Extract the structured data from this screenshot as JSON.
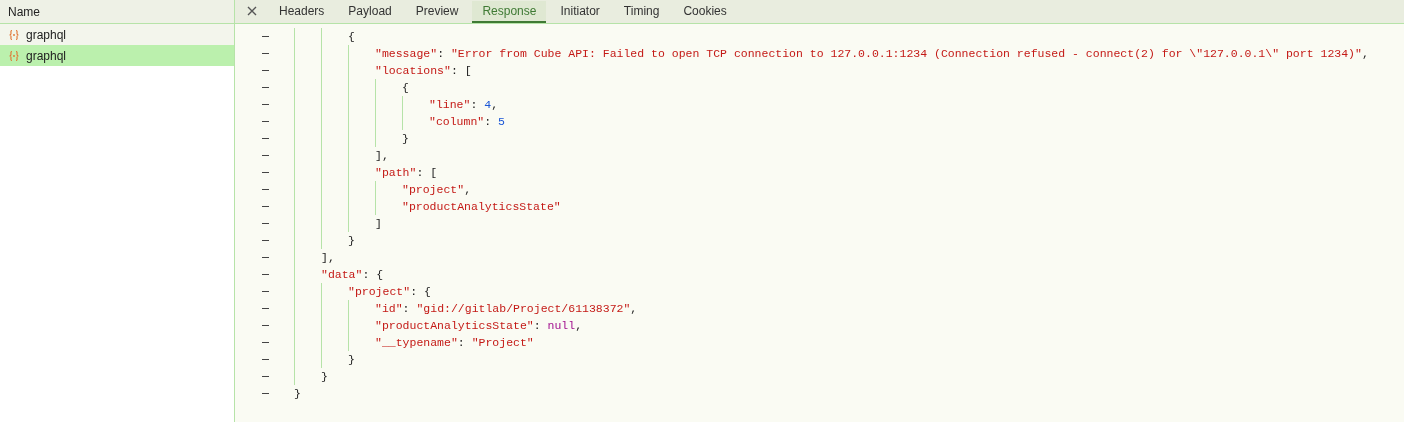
{
  "sidebar": {
    "header": "Name",
    "items": [
      {
        "label": "graphql",
        "selected": false
      },
      {
        "label": "graphql",
        "selected": true
      }
    ]
  },
  "tabs": [
    {
      "label": "Headers",
      "selected": false
    },
    {
      "label": "Payload",
      "selected": false
    },
    {
      "label": "Preview",
      "selected": false
    },
    {
      "label": "Response",
      "selected": true
    },
    {
      "label": "Initiator",
      "selected": false
    },
    {
      "label": "Timing",
      "selected": false
    },
    {
      "label": "Cookies",
      "selected": false
    }
  ],
  "response": [
    {
      "children": [
        {
          "children": [
            {
              "tokens": [
                {
                  "kind": "punct",
                  "text": "{"
                }
              ],
              "children": [
                {
                  "tokens": [
                    {
                      "kind": "key",
                      "text": "\"message\""
                    },
                    {
                      "kind": "punct",
                      "text": ": "
                    },
                    {
                      "kind": "string",
                      "text": "\"Error from Cube API: Failed to open TCP connection to 127.0.0.1:1234 (Connection refused - connect(2) for \\\"127.0.0.1\\\" port 1234)\""
                    },
                    {
                      "kind": "punct",
                      "text": ","
                    }
                  ]
                },
                {
                  "tokens": [
                    {
                      "kind": "key",
                      "text": "\"locations\""
                    },
                    {
                      "kind": "punct",
                      "text": ": ["
                    }
                  ],
                  "children": [
                    {
                      "tokens": [
                        {
                          "kind": "punct",
                          "text": "{"
                        }
                      ],
                      "children": [
                        {
                          "tokens": [
                            {
                              "kind": "key",
                              "text": "\"line\""
                            },
                            {
                              "kind": "punct",
                              "text": ": "
                            },
                            {
                              "kind": "number",
                              "text": "4"
                            },
                            {
                              "kind": "punct",
                              "text": ","
                            }
                          ]
                        },
                        {
                          "tokens": [
                            {
                              "kind": "key",
                              "text": "\"column\""
                            },
                            {
                              "kind": "punct",
                              "text": ": "
                            },
                            {
                              "kind": "number",
                              "text": "5"
                            }
                          ]
                        }
                      ]
                    },
                    {
                      "tokens": [
                        {
                          "kind": "punct",
                          "text": "}"
                        }
                      ]
                    }
                  ]
                },
                {
                  "tokens": [
                    {
                      "kind": "punct",
                      "text": "],"
                    }
                  ]
                },
                {
                  "tokens": [
                    {
                      "kind": "key",
                      "text": "\"path\""
                    },
                    {
                      "kind": "punct",
                      "text": ": ["
                    }
                  ],
                  "children": [
                    {
                      "tokens": [
                        {
                          "kind": "string",
                          "text": "\"project\""
                        },
                        {
                          "kind": "punct",
                          "text": ","
                        }
                      ]
                    },
                    {
                      "tokens": [
                        {
                          "kind": "string",
                          "text": "\"productAnalyticsState\""
                        }
                      ]
                    }
                  ]
                },
                {
                  "tokens": [
                    {
                      "kind": "punct",
                      "text": "]"
                    }
                  ]
                }
              ]
            },
            {
              "tokens": [
                {
                  "kind": "punct",
                  "text": "}"
                }
              ]
            }
          ]
        },
        {
          "tokens": [
            {
              "kind": "punct",
              "text": "],"
            }
          ]
        },
        {
          "tokens": [
            {
              "kind": "key",
              "text": "\"data\""
            },
            {
              "kind": "punct",
              "text": ": {"
            }
          ],
          "children": [
            {
              "tokens": [
                {
                  "kind": "key",
                  "text": "\"project\""
                },
                {
                  "kind": "punct",
                  "text": ": {"
                }
              ],
              "children": [
                {
                  "tokens": [
                    {
                      "kind": "key",
                      "text": "\"id\""
                    },
                    {
                      "kind": "punct",
                      "text": ": "
                    },
                    {
                      "kind": "string",
                      "text": "\"gid://gitlab/Project/61138372\""
                    },
                    {
                      "kind": "punct",
                      "text": ","
                    }
                  ]
                },
                {
                  "tokens": [
                    {
                      "kind": "key",
                      "text": "\"productAnalyticsState\""
                    },
                    {
                      "kind": "punct",
                      "text": ": "
                    },
                    {
                      "kind": "null",
                      "text": "null"
                    },
                    {
                      "kind": "punct",
                      "text": ","
                    }
                  ]
                },
                {
                  "tokens": [
                    {
                      "kind": "key",
                      "text": "\"__typename\""
                    },
                    {
                      "kind": "punct",
                      "text": ": "
                    },
                    {
                      "kind": "string",
                      "text": "\"Project\""
                    }
                  ]
                }
              ]
            },
            {
              "tokens": [
                {
                  "kind": "punct",
                  "text": "}"
                }
              ]
            }
          ]
        },
        {
          "tokens": [
            {
              "kind": "punct",
              "text": "}"
            }
          ]
        }
      ]
    },
    {
      "tokens": [
        {
          "kind": "punct",
          "text": "}"
        }
      ]
    }
  ]
}
